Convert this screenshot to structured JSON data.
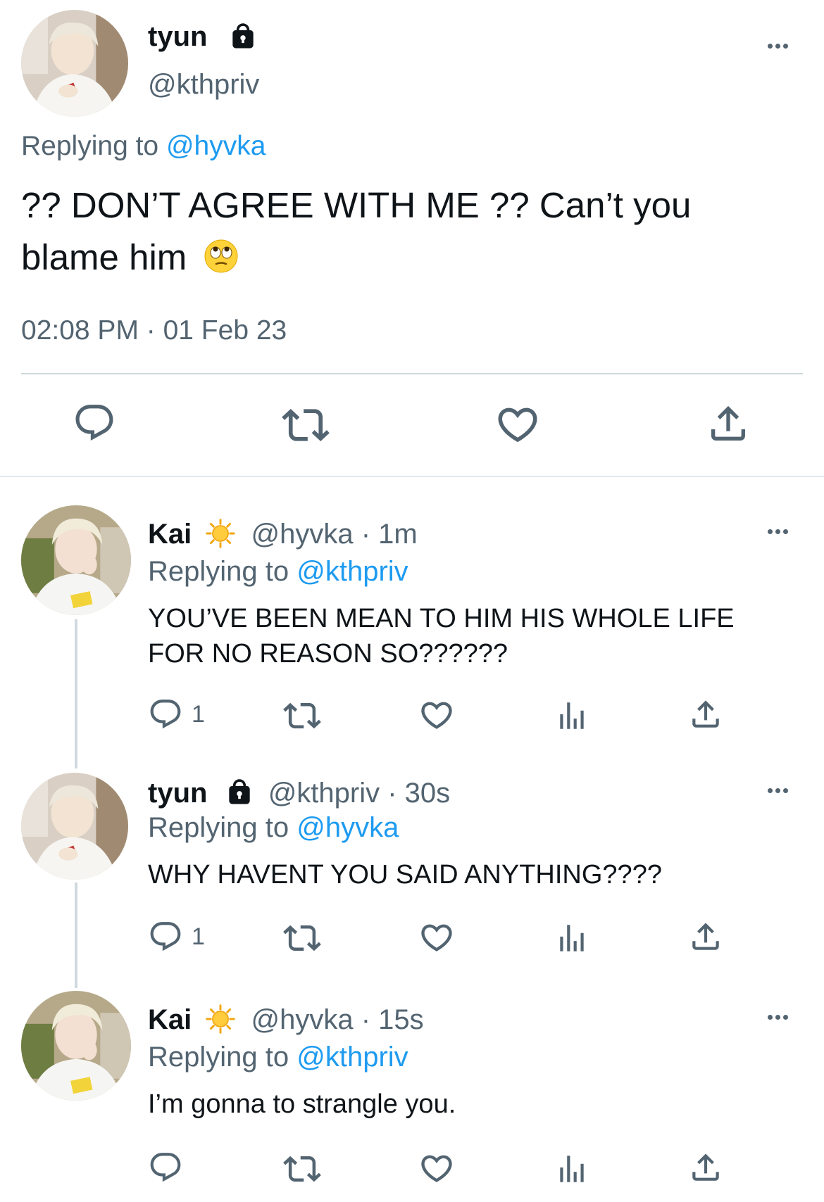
{
  "main_tweet": {
    "display_name": "tyun",
    "handle": "@kthpriv",
    "replying_prefix": "Replying to ",
    "replying_handle": "@hyvka",
    "text_line1": "?? DON’T AGREE WITH ME ?? Can’t you",
    "text_line2": "blame him",
    "emoji": "🙄",
    "timestamp": "02:08 PM · 01 Feb 23"
  },
  "replies": [
    {
      "display_name": "Kai",
      "handle_time": "@hyvka · 1m",
      "replying_prefix": "Replying to ",
      "replying_handle": "@kthpriv",
      "text_line1": "YOU’VE BEEN MEAN TO HIM HIS WHOLE LIFE",
      "text_line2": "FOR NO REASON SO??????",
      "reply_count": "1"
    },
    {
      "display_name": "tyun",
      "handle_time": "@kthpriv · 30s",
      "replying_prefix": "Replying to ",
      "replying_handle": "@hyvka",
      "text_line1": "WHY HAVENT YOU SAID ANYTHING????",
      "reply_count": "1"
    },
    {
      "display_name": "Kai",
      "handle_time": "@hyvka · 15s",
      "replying_prefix": "Replying to ",
      "replying_handle": "@kthpriv",
      "text_line1": "I’m gonna to strangle you.",
      "reply_count": ""
    }
  ],
  "icons": {
    "lock": "lock-icon",
    "sun": "sun-icon",
    "reply": "reply-icon",
    "retweet": "retweet-icon",
    "like": "like-icon",
    "analytics": "analytics-icon",
    "share": "share-icon",
    "more": "more-icon"
  },
  "colors": {
    "link": "#1d9bf0",
    "secondary_text": "#536471",
    "divider": "#cfd9de"
  }
}
